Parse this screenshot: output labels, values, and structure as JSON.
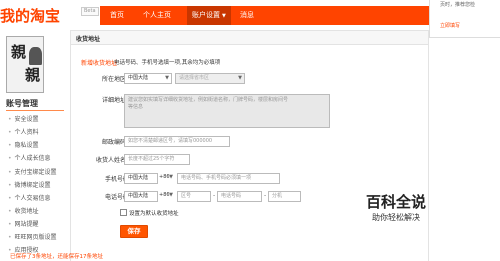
{
  "header": {
    "logo": "我的淘宝",
    "beta": "Beta",
    "nav": [
      {
        "label": "首页"
      },
      {
        "label": "个人主页"
      },
      {
        "label": "账户设置",
        "dropdown": "▼"
      },
      {
        "label": "消息"
      }
    ],
    "right_panel": {
      "line1": "页时，推荐您检",
      "line2": "立即填写"
    }
  },
  "sidebar": {
    "avatar_text": [
      "親",
      "親"
    ],
    "title": "账号管理",
    "items": [
      {
        "label": "安全设置"
      },
      {
        "label": "个人资料"
      },
      {
        "label": "隐私设置"
      },
      {
        "label": "个人成长信息"
      },
      {
        "label": "支付宝绑定设置"
      },
      {
        "label": "微博绑定设置"
      },
      {
        "label": "个人交易信息"
      },
      {
        "label": "收货地址"
      },
      {
        "label": "网站提醒"
      },
      {
        "label": "旺旺网页版设置"
      },
      {
        "label": "应用授权"
      }
    ]
  },
  "main": {
    "title": "收货地址",
    "tab_new": "新增收货地址",
    "hint": "电话号码、手机号选填一项,其余均为必填项",
    "form": {
      "region": {
        "label": "所在地区",
        "country": "中国大陆",
        "placeholder": "请选择省市区"
      },
      "address": {
        "label": "详细地址",
        "placeholder_line1": "建议您如实填写详细收货地址，例如街道名称，门牌号码，楼层和房间号",
        "placeholder_line2": "等信息"
      },
      "postcode": {
        "label": "邮政编码",
        "placeholder": "如您不清楚邮递区号，请填写000000"
      },
      "name": {
        "label": "收货人姓名",
        "placeholder": "长度不超过25个字符"
      },
      "mobile": {
        "label": "手机号码",
        "country": "中国大陆",
        "code": "+86",
        "placeholder": "电话号码、手机号码必须填一项"
      },
      "phone": {
        "label": "电话号码",
        "country": "中国大陆",
        "code": "+86",
        "area_placeholder": "区号",
        "number_placeholder": "电话号码",
        "ext_placeholder": "分机",
        "dash": "-"
      },
      "default_checkbox": {
        "label": "设置为默认收货地址"
      },
      "required_mark": "*",
      "caret": "▼"
    },
    "save_label": "保存",
    "bottom_note": "已保存了3条地址，还能保存17条地址"
  },
  "watermark": {
    "line1": "百科全说",
    "line2": "助你轻松解决"
  },
  "colors": {
    "accent": "#ff4400",
    "nav_active": "#c93600"
  },
  "icons": {
    "checkbox": "checkbox-icon",
    "dropdown": "chevron-down-icon"
  }
}
